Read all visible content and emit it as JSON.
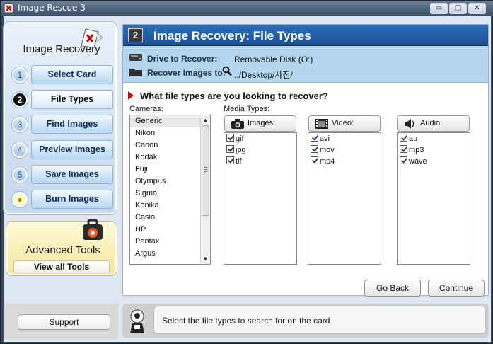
{
  "window": {
    "title": "Image Rescue 3",
    "controls": {
      "minimize": "▭",
      "maximize": "□",
      "close": "✕"
    }
  },
  "sidebar": {
    "title": "Image Recovery",
    "steps": [
      {
        "num": "1",
        "label": "Select Card"
      },
      {
        "num": "2",
        "label": "File Types"
      },
      {
        "num": "3",
        "label": "Find Images"
      },
      {
        "num": "4",
        "label": "Preview Images"
      },
      {
        "num": "5",
        "label": "Save Images"
      },
      {
        "num": "●",
        "label": "Burn Images"
      }
    ],
    "active_step": 2
  },
  "advanced": {
    "title": "Advanced Tools",
    "button": "View all Tools"
  },
  "header": {
    "number": "2",
    "title": "Image Recovery: File Types"
  },
  "info": {
    "drive_label": "Drive to Recover:",
    "drive_value": "Removable Disk (O:)",
    "recover_label": "Recover Images to:",
    "recover_value": "../Desktop/사진/"
  },
  "question": "What file types are you looking to recover?",
  "cameras": {
    "label": "Cameras:",
    "items": [
      "Generic",
      "Nikon",
      "Canon",
      "Kodak",
      "Fuji",
      "Olympus",
      "Sigma",
      "Konika",
      "Casio",
      "HP",
      "Pentax",
      "Argus"
    ],
    "selected": "Generic"
  },
  "media": {
    "label": "Media Types:",
    "images": {
      "label": "Images:",
      "items": [
        "gif",
        "jpg",
        "tif"
      ]
    },
    "video": {
      "label": "Video:",
      "items": [
        "avi",
        "mov",
        "mp4"
      ]
    },
    "audio": {
      "label": "Audio:",
      "items": [
        "au",
        "mp3",
        "wave"
      ]
    }
  },
  "nav": {
    "back": "Go Back",
    "continue": "Continue"
  },
  "footer": {
    "support": "Support",
    "status": "Select the file types to search for on the card"
  },
  "colors": {
    "header_blue": "#1f5aa6",
    "info_blue": "#b4d6ee",
    "sidebar_blue": "#c4d7ec",
    "advanced_yellow": "#f4e79a",
    "question_arrow": "#d40000"
  }
}
